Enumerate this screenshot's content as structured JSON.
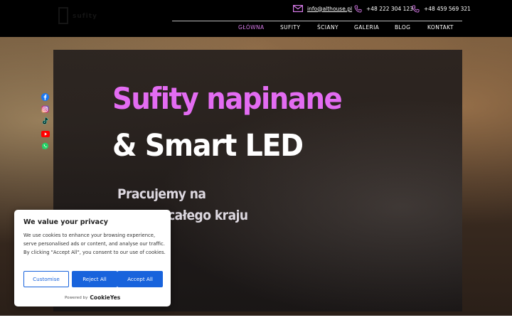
{
  "header": {
    "logo_text": "sufity",
    "email": "info@althouse.pl",
    "phone1": "+48 222 304 123",
    "phone2": "+48 459 569 321"
  },
  "nav": {
    "items": [
      {
        "label": "GŁÓWNA",
        "active": true
      },
      {
        "label": "SUFITY"
      },
      {
        "label": "ŚCIANY"
      },
      {
        "label": "GALERIA"
      },
      {
        "label": "BLOG"
      },
      {
        "label": "KONTAKT"
      }
    ]
  },
  "hero": {
    "title_line1": "Sufity napinane",
    "title_line2": "& Smart LED",
    "subtitle_line1": "Pracujemy na",
    "subtitle_line2": "terenie całego kraju"
  },
  "social": [
    "facebook-icon",
    "instagram-icon",
    "tiktok-icon",
    "youtube-icon",
    "whatsapp-icon"
  ],
  "cookie": {
    "title": "We value your privacy",
    "body": "We use cookies to enhance your browsing experience, serve personalised ads or content, and analyse our traffic. By clicking \"Accept All\", you consent to our use of cookies.",
    "customise": "Customise",
    "reject": "Reject All",
    "accept": "Accept All",
    "powered": "Powered by",
    "brand": "CookieYes"
  },
  "colors": {
    "accent": "#e36cf2",
    "nav_active": "#d77ae9",
    "button": "#1863dc"
  }
}
